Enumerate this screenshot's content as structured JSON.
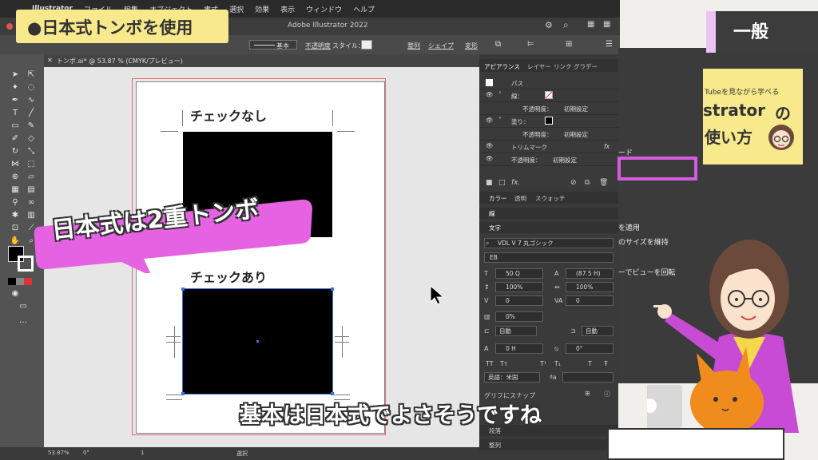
{
  "menubar": {
    "items": [
      "Illustrator",
      "ファイル",
      "編集",
      "オブジェクト",
      "書式",
      "選択",
      "効果",
      "表示",
      "ウィンドウ",
      "ヘルプ"
    ]
  },
  "app": {
    "title": "Adobe Illustrator 2022"
  },
  "controlbar": {
    "stroke_style": "基本",
    "opacity_label": "不透明度",
    "style_label": "スタイル：",
    "align": "整列",
    "shape": "シェイプ",
    "transform": "変形"
  },
  "document": {
    "tab": "トンボ.ai* @ 53.87 % (CMYK/プレビュー)",
    "label_top": "チェックなし",
    "label_bottom": "チェックあり"
  },
  "status": {
    "zoom": "53.87%",
    "rotate": "0°",
    "page": "1",
    "mode": "選択"
  },
  "appearance_panel": {
    "tabs": [
      "アピアランス",
      "レイヤー",
      "リンク",
      "グラデー"
    ],
    "object": "パス",
    "rows": [
      {
        "label": "線：",
        "indent": 1
      },
      {
        "label": "不透明度：",
        "value": "初期設定",
        "indent": 2
      },
      {
        "label": "塗り：",
        "indent": 1
      },
      {
        "label": "不透明度：",
        "value": "初期設定",
        "indent": 2
      },
      {
        "label": "トリムマーク",
        "value": "fx",
        "indent": 1
      },
      {
        "label": "不透明度：",
        "value": "初期設定",
        "indent": 1
      }
    ]
  },
  "color_panel": {
    "tabs": [
      "カラー",
      "透明",
      "スウォッチ"
    ]
  },
  "stroke_panel": {
    "tab": "線"
  },
  "character_panel": {
    "tab": "文字",
    "font": "VDL V 7 丸ゴシック",
    "weight": "EB",
    "size": "50 Q",
    "leading": "(87.5 H)",
    "vscale": "100%",
    "hscale": "100%",
    "kerning": "0",
    "tracking": "0",
    "tsume": "0%",
    "aki_before": "自動",
    "aki_after": "自動",
    "baseline": "0 H",
    "rotation": "0°",
    "language": "英語：米国",
    "snap": "グリフにスナップ",
    "footer_tabs": [
      "段落",
      "整列"
    ]
  },
  "dialog_bg": {
    "lines": [
      "ード",
      "を適用",
      "のサイズを維持",
      "ーでビューを回転"
    ]
  },
  "overlay": {
    "title_tag": "●日本式トンボを使用",
    "section": "一般",
    "promo_small": "Tubeを見ながら学べる",
    "promo_big1": "strator",
    "promo_big1b": "の",
    "promo_big2": "使い方",
    "bubble": "日本式は2重トンボ",
    "caption": "基本は日本式でよさそうですね"
  },
  "colors": {
    "accent_pink": "#d55ce0",
    "tag_yellow": "#f8e98c",
    "panel": "#3a3a3a"
  }
}
